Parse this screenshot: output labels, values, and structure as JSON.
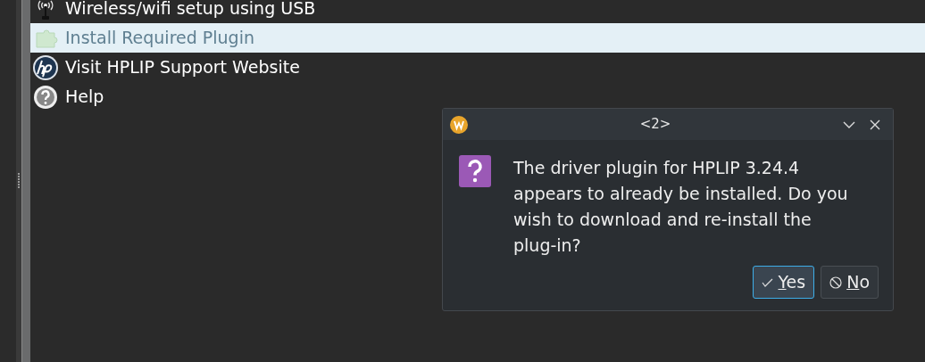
{
  "list": {
    "items": [
      {
        "kind": "wifi",
        "label": "Wireless/wifi setup using USB",
        "selected": false
      },
      {
        "kind": "plugin",
        "label": "Install Required Plugin",
        "selected": true
      },
      {
        "kind": "hp",
        "label": "Visit HPLIP Support Website",
        "selected": false
      },
      {
        "kind": "help",
        "label": "Help",
        "selected": false
      }
    ]
  },
  "dialog": {
    "title": "<2>",
    "message": "The driver plugin for HPLIP 3.24.4 appears to already be installed. Do you wish to download and re-install the plug-in?",
    "buttons": [
      {
        "kind": "yes",
        "label": "Yes",
        "default": true,
        "mnemonic": true
      },
      {
        "kind": "no",
        "label": "No",
        "default": false,
        "mnemonic": true
      }
    ]
  }
}
